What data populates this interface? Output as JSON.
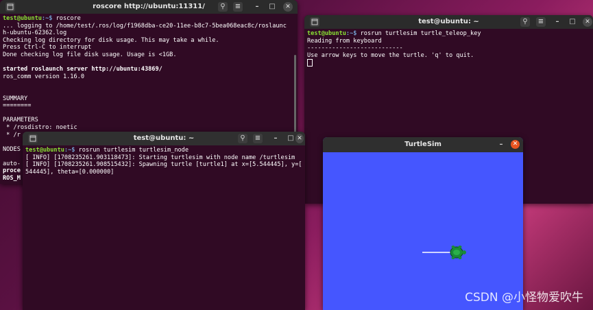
{
  "windows": {
    "roscore": {
      "title": "roscore http://ubuntu:11311/",
      "lines": {
        "l1_user": "test@ubuntu",
        "l1_path": ":~$",
        "l1_cmd": " roscore",
        "l2": "... logging to /home/test/.ros/log/f1968dba-ce20-11ee-b8c7-5bea068eac8c/roslaunc",
        "l3": "h-ubuntu-62362.log",
        "l4": "Checking log directory for disk usage. This may take a while.",
        "l5": "Press Ctrl-C to interrupt",
        "l6": "Done checking log file disk usage. Usage is <1GB.",
        "l7": "started roslaunch server http://ubuntu:43869/",
        "l8": "ros_comm version 1.16.0",
        "l9": "SUMMARY",
        "l10": "========",
        "l11": "PARAMETERS",
        "l12": " * /rosdistro: noetic",
        "l13": " * /r",
        "l14": "NODES",
        "l15": "auto-",
        "l16": "proce",
        "l17": "ROS_M"
      }
    },
    "teleop": {
      "title": "test@ubuntu: ~",
      "lines": {
        "l1_user": "test@ubuntu",
        "l1_path": ":~$",
        "l1_cmd": " rosrun turtlesim turtle_teleop_key",
        "l2": "Reading from keyboard",
        "l3": "---------------------------",
        "l4": "Use arrow keys to move the turtle. 'q' to quit."
      }
    },
    "turtlesim_node": {
      "title": "test@ubuntu: ~",
      "lines": {
        "l1_user": "test@ubuntu",
        "l1_path": ":~$",
        "l1_cmd": " rosrun turtlesim turtlesim_node",
        "l2": "[ INFO] [1708235261.903118473]: Starting turtlesim with node name /turtlesim",
        "l3": "[ INFO] [1708235261.908515432]: Spawning turtle [turtle1] at x=[5.544445], y=[",
        "l4": "544445], theta=[0.000000]"
      }
    },
    "turtlesim_window": {
      "title": "TurtleSim",
      "background": "#4556ff"
    }
  },
  "icons": {
    "terminal": "terminal-icon",
    "search": "search-icon",
    "menu": "hamburger-menu-icon",
    "minimize": "minimize-icon",
    "maximize": "maximize-icon",
    "close": "close-icon"
  },
  "watermark": "CSDN @小怪物爱吹牛"
}
